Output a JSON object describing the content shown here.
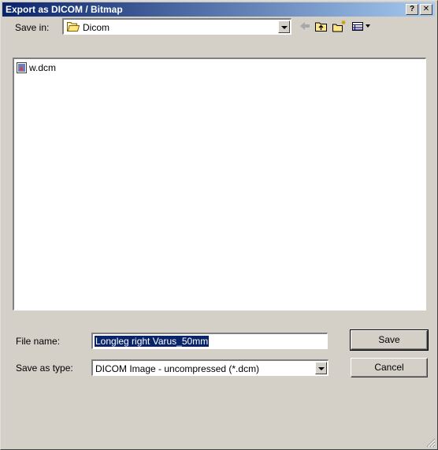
{
  "window": {
    "title": "Export as DICOM / Bitmap",
    "help_label": "?",
    "close_label": "✕"
  },
  "save_in": {
    "label": "Save in:",
    "value": "Dicom",
    "icon": "folder-icon"
  },
  "toolbar": {
    "icons": [
      "back-icon",
      "up-folder-icon",
      "new-folder-icon",
      "view-menu-icon"
    ]
  },
  "files": [
    {
      "name": "w.dcm",
      "icon": "dicom-file-icon"
    }
  ],
  "file_name": {
    "label": "File name:",
    "value": "Longleg right Varus_50mm"
  },
  "save_as_type": {
    "label": "Save as type:",
    "value": "DICOM Image - uncompressed (*.dcm)"
  },
  "buttons": {
    "save": "Save",
    "cancel": "Cancel"
  },
  "colors": {
    "title_start": "#0a246a",
    "title_end": "#a6caf0",
    "face": "#d4d0c8",
    "selection": "#0a246a"
  }
}
